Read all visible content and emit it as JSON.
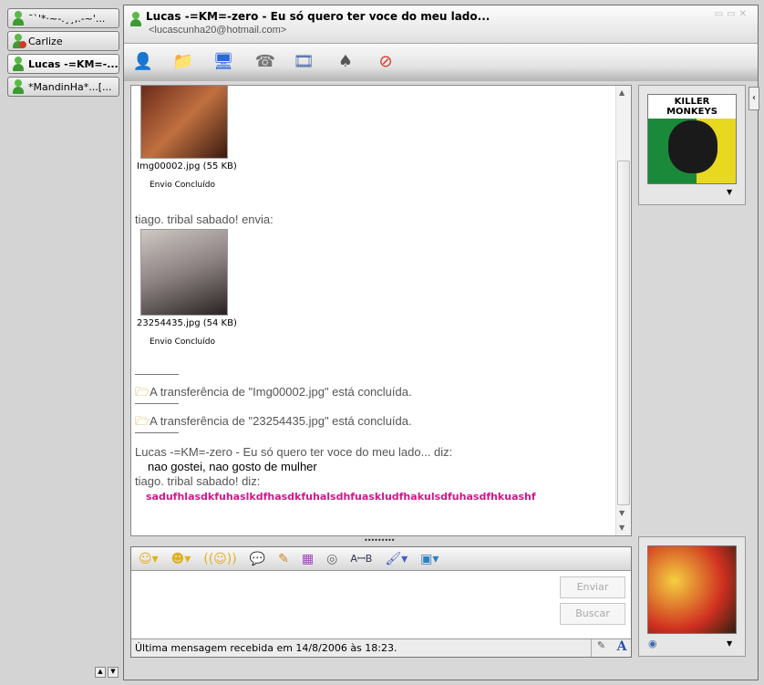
{
  "sidebar": {
    "tabs": [
      {
        "label": "¯`'*·~-.¸¸,.-~'...",
        "status": "online"
      },
      {
        "label": "Carlize",
        "status": "blocked"
      },
      {
        "label": "Lucas -=KM=-...",
        "status": "online",
        "active": true
      },
      {
        "label": "*MandinHa*...[...",
        "status": "online"
      }
    ]
  },
  "header": {
    "title": "Lucas -=KM=-zero - Eu só quero ter voce do meu lado...",
    "email": "<lucascunha20@hotmail.com>"
  },
  "toolbar": {
    "buttons": [
      "invite-contact",
      "send-files",
      "video-call",
      "voice-call",
      "activities",
      "games",
      "block"
    ]
  },
  "chat": {
    "transfers": [
      {
        "file": "Img00002.jpg (55 KB)",
        "status": "Envio Concluído"
      },
      {
        "file": "23254435.jpg (54 KB)",
        "status": "Envio Concluído"
      }
    ],
    "send_notice": "tiago. tribal sabado! envia:",
    "system": [
      "A transferência de \"Img00002.jpg\" está concluída.",
      "A transferência de \"23254435.jpg\" está concluída."
    ],
    "messages": [
      {
        "sender": "Lucas -=KM=-zero - Eu só quero ter voce do meu lado... diz:",
        "text": "nao gostei, nao gosto de mulher"
      },
      {
        "sender": "tiago. tribal sabado! diz:",
        "text": "sadufhlasdkfuhaslkdfhasdkfuhalsdhfuaskludfhakulsdfuhasdfhkuashf",
        "color": "#d4148c"
      }
    ]
  },
  "contact_picture": {
    "logo_text": "KILLER MONKEYS"
  },
  "input": {
    "value": "",
    "send_label": "Enviar",
    "search_label": "Buscar"
  },
  "status_bar": {
    "text": "Última mensagem recebida em 14/8/2006 às 18:23."
  },
  "colors": {
    "accent_pink": "#d4148c"
  }
}
